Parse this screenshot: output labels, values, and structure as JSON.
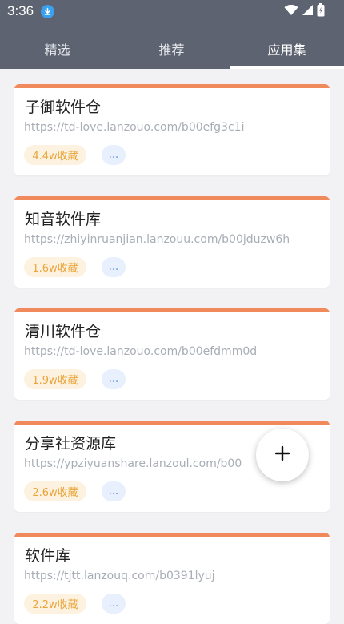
{
  "status": {
    "time": "3:36"
  },
  "tabs": [
    {
      "label": "精选"
    },
    {
      "label": "推荐"
    },
    {
      "label": "应用集"
    }
  ],
  "active_tab": "应用集",
  "cards": [
    {
      "title": "子御软件仓",
      "url": "https://td-love.lanzouo.com/b00efg3c1i",
      "favorites": "4.4w收藏",
      "more": "..."
    },
    {
      "title": "知音软件库",
      "url": "https://zhiyinruanjian.lanzouu.com/b00jduzw6h",
      "favorites": "1.6w收藏",
      "more": "..."
    },
    {
      "title": "清川软件仓",
      "url": "https://td-love.lanzouo.com/b00efdmm0d",
      "favorites": "1.9w收藏",
      "more": "..."
    },
    {
      "title": "分享社资源库",
      "url": "https://ypziyuanshare.lanzoul.com/b00",
      "favorites": "2.6w收藏",
      "more": "..."
    },
    {
      "title": "软件库",
      "url": "https://tjtt.lanzouq.com/b0391lyuj",
      "favorites": "2.2w收藏",
      "more": "..."
    }
  ],
  "fab": {
    "icon": "plus-icon"
  },
  "colors": {
    "header": "#5d6370",
    "accent": "#f08a5d",
    "badge_text": "#e9a43a",
    "badge_bg": "#fdf2e0",
    "more_bg": "#e7f0fc"
  }
}
